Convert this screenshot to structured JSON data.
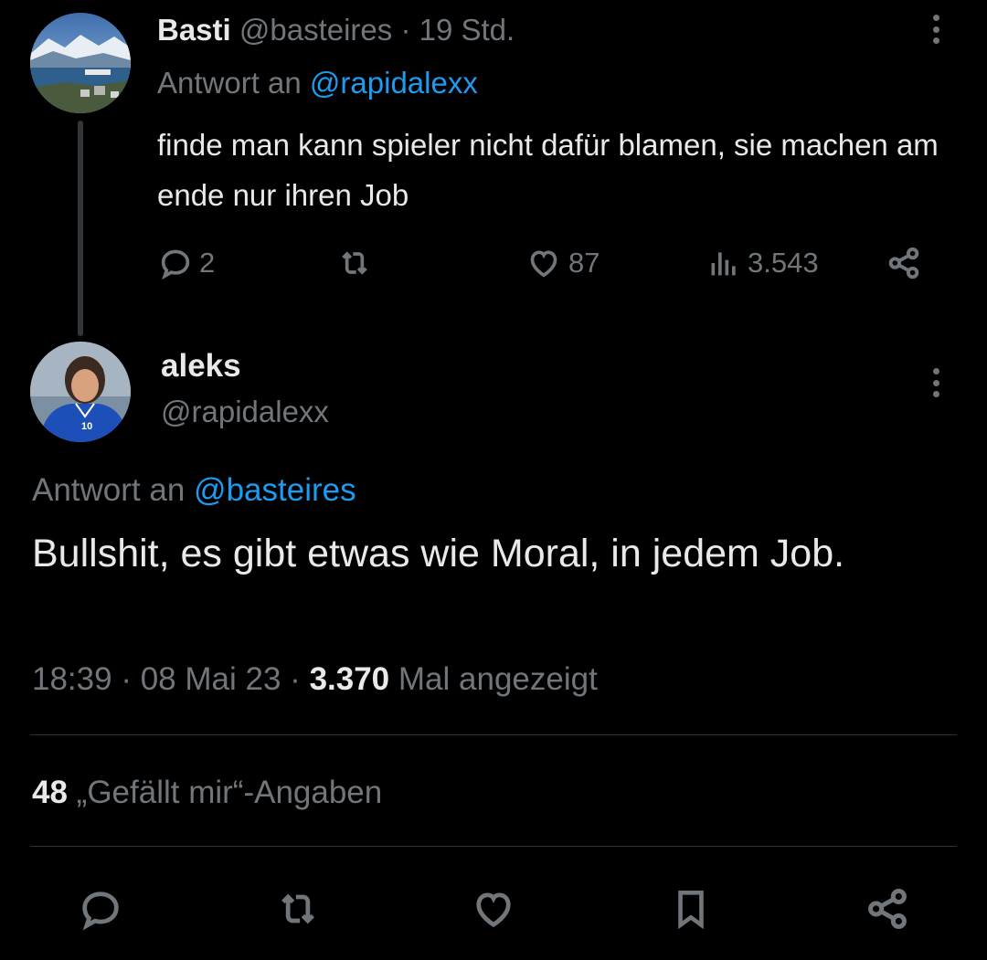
{
  "reply_tweet": {
    "display_name": "Basti",
    "handle": "@basteires",
    "separator": "·",
    "time_ago": "19 Std.",
    "reply_to_label": "Antwort an",
    "reply_to_handle": "@rapidalexx",
    "text": "finde man kann spieler nicht dafür blamen, sie machen am ende nur ihren Job",
    "replies": "2",
    "retweets": "",
    "likes": "87",
    "views": "3.543",
    "avatar": "landscape-fjord-photo"
  },
  "main_tweet": {
    "display_name": "aleks",
    "handle": "@rapidalexx",
    "reply_to_label": "Antwort an",
    "reply_to_handle": "@basteires",
    "text": "Bullshit, es gibt etwas wie Moral, in jedem Job.",
    "time": "18:39",
    "date": "08 Mai 23",
    "sep": "·",
    "views_count": "3.370",
    "views_label": "Mal angezeigt",
    "likes_count": "48",
    "likes_label": "„Gefällt mir“-Angaben",
    "avatar": "football-player-blue-jersey-photo"
  },
  "icons": {
    "reply": "reply-icon",
    "retweet": "retweet-icon",
    "like": "heart-icon",
    "views": "views-icon",
    "share": "share-icon",
    "bookmark": "bookmark-icon",
    "more": "more-icon"
  },
  "colors": {
    "background": "#000000",
    "text": "#e7e9ea",
    "muted": "#71767b",
    "link": "#1d9bf0",
    "divider": "#2f3336"
  }
}
